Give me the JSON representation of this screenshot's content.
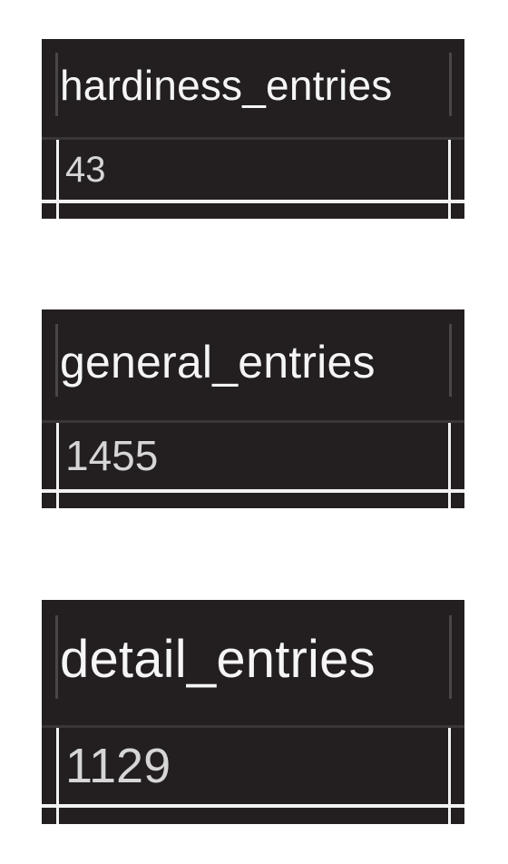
{
  "results": [
    {
      "column": "hardiness_entries",
      "value": "43"
    },
    {
      "column": "general_entries",
      "value": "1455"
    },
    {
      "column": "detail_entries",
      "value": "1129"
    }
  ],
  "colors": {
    "panel_background": "#231f20",
    "header_text": "#f5f5f5",
    "cell_text": "#d6d6d6",
    "grid_line": "#f2f2f2",
    "page_background": "#ffffff"
  }
}
